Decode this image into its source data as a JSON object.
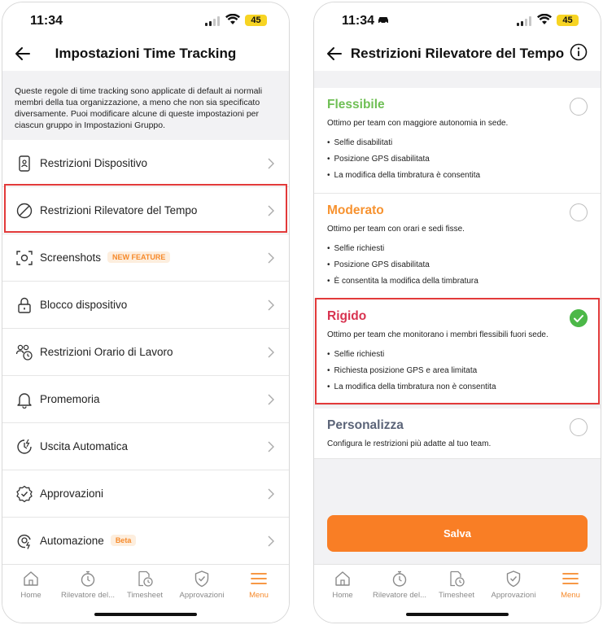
{
  "colors": {
    "accent": "#f97e25",
    "flessibile": "#6fbf55",
    "moderato": "#f7922f",
    "rigido": "#d8324f",
    "personalizza": "#5b6478",
    "highlight": "#e23a3a"
  },
  "left": {
    "status": {
      "time": "11:34",
      "battery": "45"
    },
    "header": {
      "title": "Impostazioni Time Tracking"
    },
    "description": "Queste regole di time tracking sono applicate di default ai normali membri della tua organizzazione, a meno che non sia specificato diversamente. Puoi modificare alcune di queste impostazioni per ciascun gruppo in Impostazioni Gruppo.",
    "items": [
      {
        "label": "Restrizioni Dispositivo",
        "icon": "device-icon"
      },
      {
        "label": "Restrizioni Rilevatore del Tempo",
        "icon": "prohibited-icon"
      },
      {
        "label": "Screenshots",
        "icon": "screenshot-icon",
        "badge": "NEW FEATURE"
      },
      {
        "label": "Blocco dispositivo",
        "icon": "lock-icon"
      },
      {
        "label": "Restrizioni Orario di Lavoro",
        "icon": "users-clock-icon"
      },
      {
        "label": "Promemoria",
        "icon": "bell-icon"
      },
      {
        "label": "Uscita Automatica",
        "icon": "auto-clock-out-icon"
      },
      {
        "label": "Approvazioni",
        "icon": "approval-badge-icon"
      },
      {
        "label": "Automazione",
        "icon": "automation-icon",
        "badge": "Beta"
      }
    ]
  },
  "right": {
    "status": {
      "time": "11:34",
      "battery": "45"
    },
    "header": {
      "title": "Restrizioni Rilevatore del Tempo"
    },
    "options": [
      {
        "title": "Flessibile",
        "description": "Ottimo per team con maggiore autonomia in sede.",
        "bullets": [
          "Selfie disabilitati",
          "Posizione GPS disabilitata",
          "La modifica della timbratura è consentita"
        ],
        "selected": false
      },
      {
        "title": "Moderato",
        "description": "Ottimo per team con orari e sedi fisse.",
        "bullets": [
          "Selfie richiesti",
          "Posizione GPS disabilitata",
          "È consentita la modifica della timbratura"
        ],
        "selected": false
      },
      {
        "title": "Rigido",
        "description": "Ottimo per team che monitorano i membri flessibili fuori sede.",
        "bullets": [
          "Selfie richiesti",
          "Richiesta posizione GPS e area limitata",
          "La modifica della timbratura non è consentita"
        ],
        "selected": true
      },
      {
        "title": "Personalizza",
        "description": "Configura le restrizioni più adatte al tuo team.",
        "bullets": [],
        "selected": false
      }
    ],
    "save_label": "Salva"
  },
  "tabs": [
    {
      "label": "Home",
      "icon": "home-icon",
      "active": false
    },
    {
      "label": "Rilevatore del...",
      "icon": "stopwatch-icon",
      "active": false
    },
    {
      "label": "Timesheet",
      "icon": "timesheet-icon",
      "active": false
    },
    {
      "label": "Approvazioni",
      "icon": "shield-check-icon",
      "active": false
    },
    {
      "label": "Menu",
      "icon": "menu-icon",
      "active": true
    }
  ]
}
